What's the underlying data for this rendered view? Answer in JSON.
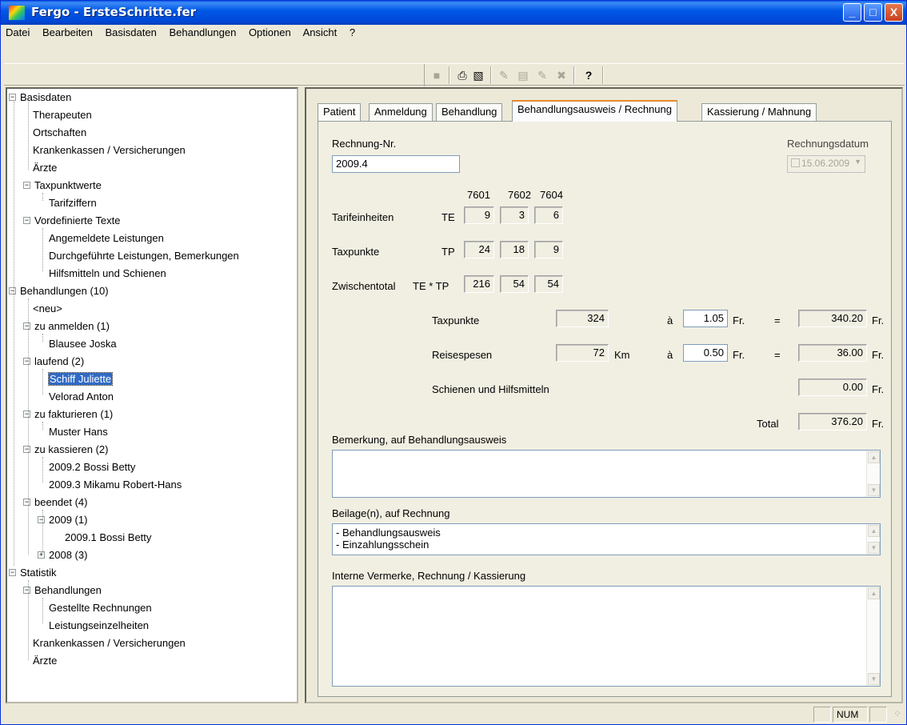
{
  "window": {
    "title": "Fergo - ErsteSchritte.fer",
    "min_label": "_",
    "max_label": "□",
    "close_label": "X"
  },
  "menu": [
    "Datei",
    "Bearbeiten",
    "Basisdaten",
    "Behandlungen",
    "Optionen",
    "Ansicht",
    "?"
  ],
  "toolbar": {
    "icons": [
      "save-icon",
      "print-icon",
      "print-preview-icon",
      "new-record-icon",
      "copy-record-icon",
      "edit-record-icon",
      "delete-record-icon",
      "help-icon"
    ]
  },
  "tree": {
    "basisdaten": "Basisdaten",
    "therapeuten": "Therapeuten",
    "ortschaften": "Ortschaften",
    "krankenkassen": "Krankenkassen / Versicherungen",
    "aerzte": "Ärzte",
    "taxpunktwerte": "Taxpunktwerte",
    "tarifziffern": "Tarifziffern",
    "vordefinierte": "Vordefinierte Texte",
    "angemeldete": "Angemeldete Leistungen",
    "durchgefuehrte": "Durchgeführte Leistungen, Bemerkungen",
    "hilfsmitteln": "Hilfsmitteln und Schienen",
    "behandlungen": "Behandlungen  (10)",
    "neu": "<neu>",
    "zu_anmelden": "zu anmelden  (1)",
    "blausee": "Blausee Joska",
    "laufend": "laufend  (2)",
    "schiff": "Schiff Juliette",
    "velorad": "Velorad Anton",
    "zu_fakturieren": "zu fakturieren  (1)",
    "muster": "Muster Hans",
    "zu_kassieren": "zu kassieren  (2)",
    "bossi2": "2009.2  Bossi Betty",
    "mikamu": "2009.3  Mikamu Robert-Hans",
    "beendet": "beendet  (4)",
    "y2009": "2009  (1)",
    "bossi1": "2009.1  Bossi Betty",
    "y2008": "2008  (3)",
    "statistik": "Statistik",
    "stat_behandlungen": "Behandlungen",
    "gestellte": "Gestellte Rechnungen",
    "leistung": "Leistungseinzelheiten",
    "stat_kk": "Krankenkassen / Versicherungen",
    "stat_aerzte": "Ärzte"
  },
  "tabs": [
    "Patient",
    "Anmeldung",
    "Behandlung",
    "Behandlungsausweis / Rechnung",
    "Kassierung / Mahnung"
  ],
  "form": {
    "rechnung_nr_label": "Rechnung-Nr.",
    "rechnung_nr": "2009.4",
    "rechnungsdatum_label": "Rechnungsdatum",
    "rechnungsdatum": "15.06.2009",
    "codes": [
      "7601",
      "7602",
      "7604"
    ],
    "tarifeinheiten_label": "Tarifeinheiten",
    "te": "TE",
    "te_values": [
      "9",
      "3",
      "6"
    ],
    "taxpunkte_label": "Taxpunkte",
    "tp": "TP",
    "tp_values": [
      "24",
      "18",
      "9"
    ],
    "zwischentotal_label": "Zwischentotal",
    "te_tp": "TE * TP",
    "zt_values": [
      "216",
      "54",
      "54"
    ],
    "tp_sum_label": "Taxpunkte",
    "tp_sum": "324",
    "a": "à",
    "tp_rate": "1.05",
    "fr": "Fr.",
    "eq": "=",
    "tp_amount": "340.20",
    "reise_label": "Reisespesen",
    "reise_km": "72",
    "km": "Km",
    "reise_rate": "0.50",
    "reise_amount": "36.00",
    "schienen_label": "Schienen und Hilfsmitteln",
    "schienen_amount": "0.00",
    "total_label": "Total",
    "total_amount": "376.20",
    "bemerkung_label": "Bemerkung, auf Behandlungsausweis",
    "beilagen_label": "Beilage(n), auf Rechnung",
    "beilagen": [
      "- Behandlungsausweis",
      "- Einzahlungsschein"
    ],
    "interne_label": "Interne Vermerke, Rechnung / Kassierung"
  },
  "status": {
    "num": "NUM"
  }
}
